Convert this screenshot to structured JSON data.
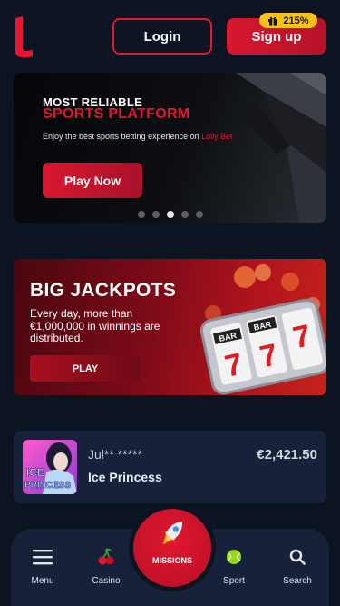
{
  "header": {
    "login_label": "Login",
    "signup_label": "Sign up",
    "bonus_badge": "215%"
  },
  "hero": {
    "kicker": "MOST RELIABLE",
    "title": "SPORTS PLATFORM",
    "description": "Enjoy the best sports betting experience on",
    "brand": "Lolly Bet",
    "cta_label": "Play Now",
    "slides_count": 5,
    "active_slide": 3
  },
  "jackpot": {
    "title": "BIG JACKPOTS",
    "description": "Every day, more than €1,000,000 in winnings are distributed.",
    "cta_label": "PLAY",
    "reel_labels": [
      "BAR",
      "BAR",
      "7",
      "7",
      "7"
    ]
  },
  "winner": {
    "user": "Jul** *****",
    "game": "Ice Princess",
    "amount": "€2,421.50",
    "thumb_text": "ICE\nPRINCESS"
  },
  "nav": {
    "items": [
      {
        "label": "Menu",
        "icon": "hamburger-icon"
      },
      {
        "label": "Casino",
        "icon": "cherries-icon"
      },
      {
        "label": "MISSIONS",
        "icon": "rocket-icon"
      },
      {
        "label": "Sport",
        "icon": "tennis-ball-icon"
      },
      {
        "label": "Search",
        "icon": "search-icon"
      }
    ]
  },
  "colors": {
    "background": "#0c1321",
    "accent": "#e3172f",
    "card": "#17223a",
    "badge": "#f5c21b"
  }
}
